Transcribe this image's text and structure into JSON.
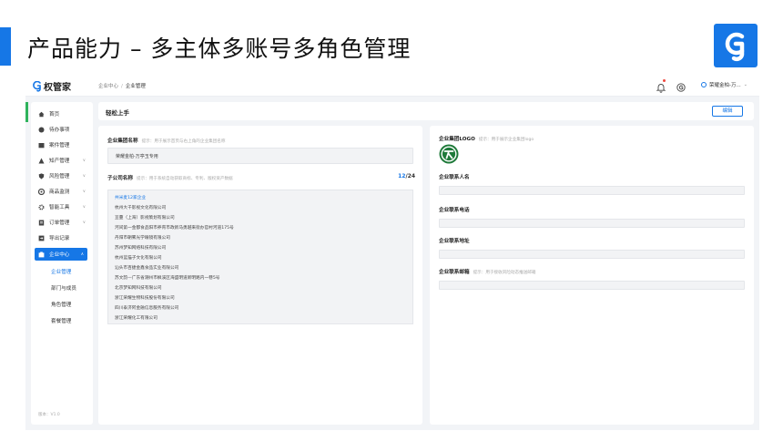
{
  "slide": {
    "title": "产品能力 – 多主体多账号多角色管理"
  },
  "brand": {
    "name": "权管家",
    "color": "#1677e6"
  },
  "breadcrumb": [
    "企业中心",
    "企业管理"
  ],
  "topbar": {
    "user_name": "荣耀金柏-万..."
  },
  "sidebar": {
    "items": [
      {
        "label": "首页",
        "icon": "home-icon"
      },
      {
        "label": "待办事项",
        "icon": "todo-icon"
      },
      {
        "label": "案件管理",
        "icon": "case-icon"
      },
      {
        "label": "知产管理",
        "icon": "ip-icon",
        "expandable": true
      },
      {
        "label": "风险管理",
        "icon": "shield-icon",
        "expandable": true
      },
      {
        "label": "商品监测",
        "icon": "monitor-icon",
        "expandable": true
      },
      {
        "label": "智能工具",
        "icon": "tools-icon",
        "expandable": true
      },
      {
        "label": "订单管理",
        "icon": "order-icon",
        "expandable": true
      },
      {
        "label": "导出记录",
        "icon": "export-icon"
      },
      {
        "label": "企业中心",
        "icon": "enterprise-icon",
        "expandable": true,
        "active": true
      }
    ],
    "sub_items": [
      {
        "label": "企业管理",
        "selected": true
      },
      {
        "label": "部门与成员"
      },
      {
        "label": "角色管理"
      },
      {
        "label": "套餐管理"
      }
    ],
    "version": "版本：V1.0"
  },
  "header": {
    "title": "轻松上手",
    "edit_label": "编辑"
  },
  "left_card": {
    "group_name_label": "企业集团名称",
    "group_name_hint": "提示：用于展示首页与右上角的企业集团名称",
    "group_name_value": "荣耀金柏-万亭玉专用",
    "sub_label": "子公司名称",
    "sub_hint": "提示：用于系统自动获取商标、专利、版权资产数据",
    "sub_count": "12",
    "sub_total": "/24",
    "companies": [
      "共米麦12家企业",
      "杭州大千影视文化有限公司",
      "亘蔓（上海）影视策划有限公司",
      "河间第一金都食品阳市养育市政新马勇越来街办官村河道175号",
      "丹阳市朝雾光学眼镜有限公司",
      "苏州梦知网络科技有限公司",
      "杭州蓝猫子文化有限公司",
      "汕头市百捷金鑫食品实业有限公司",
      "苏文韵—广东省潮州市枫溪区海盛明道新明路内一巷5号",
      "北京梦知网科技有限公司",
      "浙江荣耀生物科技股份有限公司",
      "四川泰济阿金融信息服务有限公司",
      "浙江荣耀化工有限公司"
    ]
  },
  "right_card": {
    "logo_label": "企业集团LOGO",
    "logo_hint": "提示：用于展示企业集团logo",
    "contact_name_label": "企业联系人名",
    "contact_phone_label": "企业联系电话",
    "contact_address_label": "企业联系地址",
    "contact_email_label": "企业联系邮箱",
    "contact_email_hint": "提示：用于接收风险动态推送邮箱"
  }
}
